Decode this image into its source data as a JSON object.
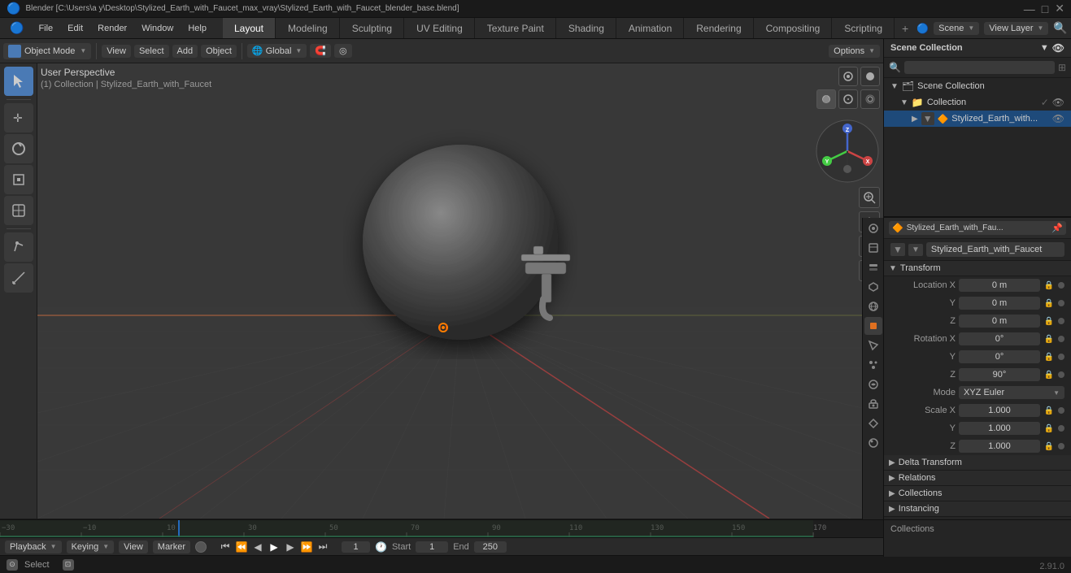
{
  "titlebar": {
    "title": "Blender [C:\\Users\\a y\\Desktop\\Stylized_Earth_with_Faucet_max_vray\\Stylized_Earth_with_Faucet_blender_base.blend]",
    "version": "2.91.0"
  },
  "menubar": {
    "items": [
      "Blender",
      "File",
      "Edit",
      "Render",
      "Window",
      "Help"
    ]
  },
  "workspace_tabs": {
    "tabs": [
      "Layout",
      "Modeling",
      "Sculpting",
      "UV Editing",
      "Texture Paint",
      "Shading",
      "Animation",
      "Rendering",
      "Compositing",
      "Scripting"
    ],
    "active": "Layout",
    "add_label": "+"
  },
  "topright": {
    "scene_label": "Scene",
    "viewlayer_label": "View Layer",
    "filter_icon": "🔍"
  },
  "header_toolbar": {
    "mode_label": "Object Mode",
    "view_label": "View",
    "select_label": "Select",
    "add_label": "Add",
    "object_label": "Object",
    "global_label": "Global",
    "snap_icon": "🧲",
    "options_label": "Options"
  },
  "viewport": {
    "info_line1": "User Perspective",
    "info_line2": "(1) Collection | Stylized_Earth_with_Faucet"
  },
  "outliner": {
    "title": "Scene Collection",
    "search_placeholder": "",
    "items": [
      {
        "label": "Collection",
        "level": 0,
        "type": "collection",
        "visible": true,
        "expanded": true
      },
      {
        "label": "Stylized_Earth_with...",
        "level": 1,
        "type": "object",
        "visible": true
      }
    ]
  },
  "properties": {
    "active_object": "Stylized_Earth_with_Fau...",
    "object_name": "Stylized_Earth_with_Faucet",
    "transform": {
      "title": "Transform",
      "location": {
        "label": "Location",
        "x": "0 m",
        "y": "0 m",
        "z": "0 m"
      },
      "rotation": {
        "label": "Rotation",
        "x": "0°",
        "y": "0°",
        "z": "90°"
      },
      "rotation_mode": "XYZ Euler",
      "scale": {
        "label": "Scale",
        "x": "1.000",
        "y": "1.000",
        "z": "1.000"
      }
    },
    "sections": [
      {
        "label": "Delta Transform",
        "expanded": false
      },
      {
        "label": "Relations",
        "expanded": false
      },
      {
        "label": "Collections",
        "expanded": false
      },
      {
        "label": "Instancing",
        "expanded": false
      }
    ]
  },
  "timeline": {
    "playback_label": "Playback",
    "keying_label": "Keying",
    "view_label": "View",
    "marker_label": "Marker",
    "current_frame": "1",
    "start_frame": "1",
    "end_frame": "250",
    "start_label": "Start",
    "end_label": "End"
  },
  "statusbar": {
    "left_label": "Select",
    "select_icon": "⊙",
    "middle_text": "",
    "right_text": "2.91.0"
  },
  "collections_bottom": {
    "label": "Collections"
  },
  "prop_icons": [
    {
      "icon": "📷",
      "name": "render-props",
      "title": "Render Properties"
    },
    {
      "icon": "📤",
      "name": "output-props",
      "title": "Output Properties"
    },
    {
      "icon": "🎬",
      "name": "view-layer-props",
      "title": "View Layer Properties"
    },
    {
      "icon": "🌍",
      "name": "scene-props",
      "title": "Scene Properties"
    },
    {
      "icon": "🌐",
      "name": "world-props",
      "title": "World Properties"
    },
    {
      "icon": "🔶",
      "name": "object-props",
      "title": "Object Properties",
      "active": true
    },
    {
      "icon": "⚙",
      "name": "modifier-props",
      "title": "Modifier Properties"
    },
    {
      "icon": "⬤",
      "name": "particles-props",
      "title": "Particles Properties"
    },
    {
      "icon": "💧",
      "name": "physics-props",
      "title": "Physics Properties"
    },
    {
      "icon": "🔲",
      "name": "constraints-props",
      "title": "Object Constraint Properties"
    },
    {
      "icon": "🔷",
      "name": "data-props",
      "title": "Object Data Properties"
    },
    {
      "icon": "🔺",
      "name": "material-props",
      "title": "Material Properties"
    }
  ],
  "colors": {
    "bg_dark": "#1a1a1a",
    "bg_mid": "#252525",
    "bg_panel": "#2a2a2a",
    "bg_btn": "#3a3a3a",
    "accent_blue": "#4a7ab5",
    "accent_orange": "#e07020",
    "grid_line": "#404040",
    "grid_line_major": "#505050",
    "selected_row": "#1e4a7a"
  }
}
